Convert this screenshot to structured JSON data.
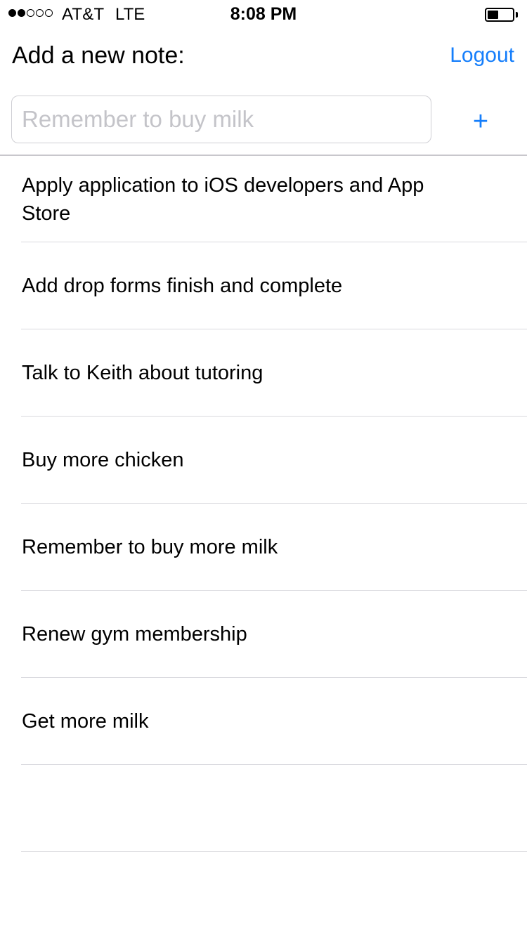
{
  "status_bar": {
    "signal_bars_filled": 2,
    "signal_bars_total": 5,
    "carrier": "AT&T",
    "network": "LTE",
    "time": "8:08 PM",
    "battery_level": 0.45
  },
  "header": {
    "title": "Add a new note:",
    "logout_label": "Logout"
  },
  "new_note": {
    "placeholder": "Remember to buy milk",
    "value": "",
    "add_label": "+"
  },
  "notes": [
    "Apply application to iOS developers and App Store",
    "Add drop forms finish and complete",
    "Talk to Keith about tutoring",
    "Buy more chicken",
    "Remember to buy more milk",
    "Renew gym membership",
    "Get more milk",
    ""
  ],
  "colors": {
    "accent": "#157efb",
    "placeholder": "#c4c4c9",
    "separator": "#d9d9de"
  }
}
